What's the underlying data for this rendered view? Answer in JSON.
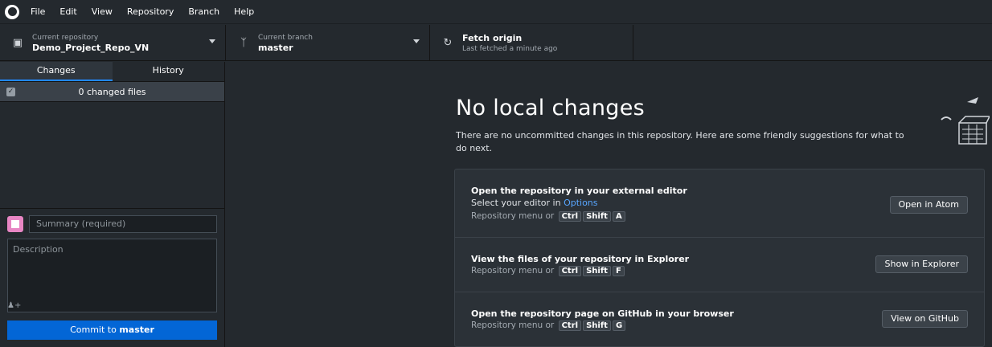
{
  "menu": [
    "File",
    "Edit",
    "View",
    "Repository",
    "Branch",
    "Help"
  ],
  "toolbar": {
    "repo": {
      "label": "Current repository",
      "value": "Demo_Project_Repo_VN"
    },
    "branch": {
      "label": "Current branch",
      "value": "master"
    },
    "fetch": {
      "label": "Fetch origin",
      "value": "Last fetched a minute ago"
    }
  },
  "sidebar": {
    "tabs": [
      {
        "label": "Changes",
        "active": true
      },
      {
        "label": "History",
        "active": false
      }
    ],
    "changed_files": "0 changed files"
  },
  "commit": {
    "summary_placeholder": "Summary (required)",
    "description_placeholder": "Description",
    "button_prefix": "Commit to",
    "button_branch": "master"
  },
  "main": {
    "title": "No local changes",
    "subtitle": "There are no uncommitted changes in this repository. Here are some friendly suggestions for what to do next.",
    "suggestions": [
      {
        "title": "Open the repository in your external editor",
        "line_prefix": "Select your editor in ",
        "line_link": "Options",
        "hint": "Repository menu or",
        "keys": [
          "Ctrl",
          "Shift",
          "A"
        ],
        "button": "Open in Atom"
      },
      {
        "title": "View the files of your repository in Explorer",
        "hint": "Repository menu or",
        "keys": [
          "Ctrl",
          "Shift",
          "F"
        ],
        "button": "Show in Explorer"
      },
      {
        "title": "Open the repository page on GitHub in your browser",
        "hint": "Repository menu or",
        "keys": [
          "Ctrl",
          "Shift",
          "G"
        ],
        "button": "View on GitHub"
      }
    ]
  },
  "colors": {
    "accent": "#0366d6",
    "link": "#58a6ff",
    "background": "#24292e"
  }
}
